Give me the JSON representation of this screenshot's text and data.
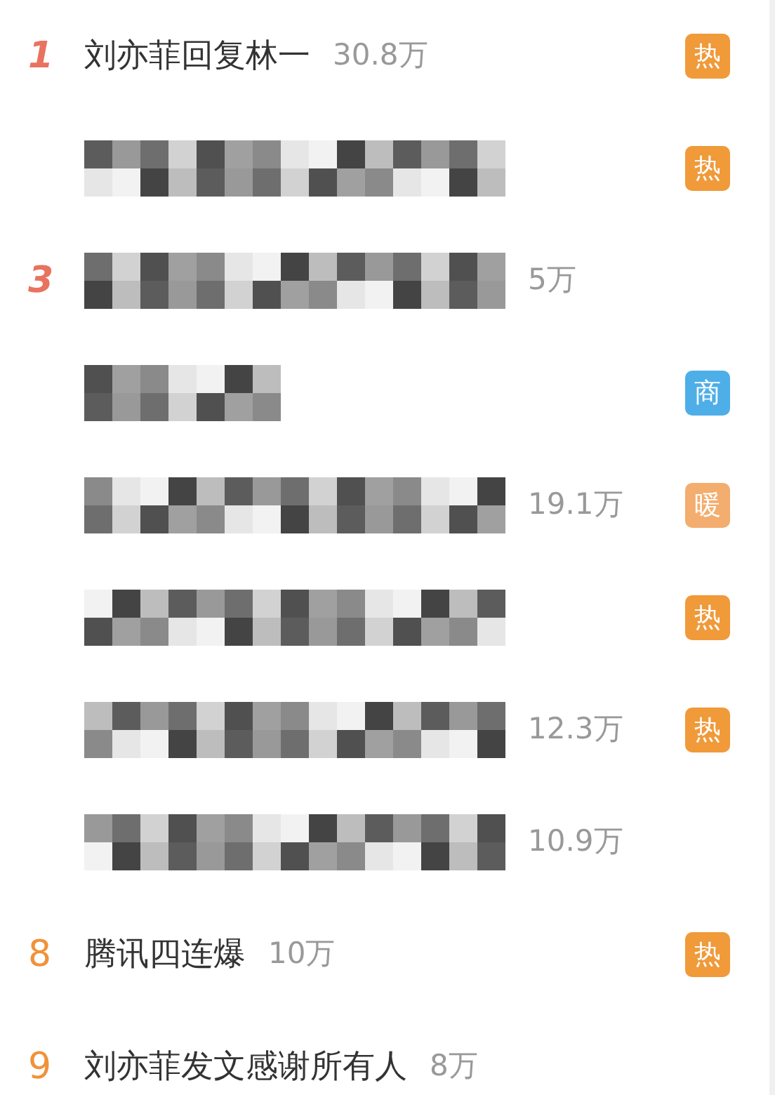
{
  "rows": [
    {
      "kind": "topic",
      "rank": {
        "text": "1",
        "color": "#e8735f",
        "italic": true
      },
      "title": "刘亦菲回复林一",
      "count": "30.8万",
      "badge": {
        "text": "热",
        "color": "#f09a3a"
      }
    },
    {
      "kind": "redacted",
      "badge": {
        "text": "热",
        "color": "#f09a3a"
      }
    },
    {
      "kind": "redacted",
      "rank": {
        "text": "3",
        "color": "#e8735f",
        "italic": true
      },
      "count": "5万"
    },
    {
      "kind": "redacted",
      "badge": {
        "text": "商",
        "color": "#4eaee8"
      }
    },
    {
      "kind": "redacted",
      "count": "19.1万",
      "badge": {
        "text": "暖",
        "color": "#f3ad6e"
      }
    },
    {
      "kind": "redacted",
      "badge": {
        "text": "热",
        "color": "#f09a3a"
      }
    },
    {
      "kind": "redacted",
      "count": "12.3万",
      "badge": {
        "text": "热",
        "color": "#f09a3a"
      }
    },
    {
      "kind": "redacted",
      "count": "10.9万"
    },
    {
      "kind": "topic",
      "rank": {
        "text": "8",
        "color": "#f0923a",
        "italic": false
      },
      "title": "腾讯四连爆",
      "count": "10万",
      "badge": {
        "text": "热",
        "color": "#f09a3a"
      }
    },
    {
      "kind": "topic",
      "rank": {
        "text": "9",
        "color": "#f0923a",
        "italic": false
      },
      "title": "刘亦菲发文感谢所有人",
      "count": "8万"
    }
  ]
}
